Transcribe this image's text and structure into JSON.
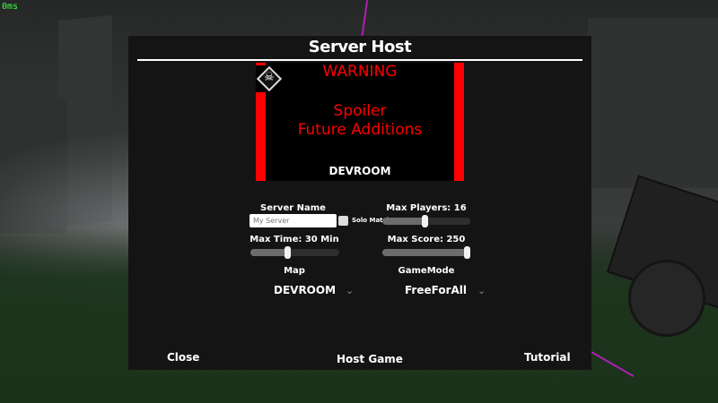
{
  "hud": {
    "fps": "0ms"
  },
  "dialog": {
    "title": "Server Host",
    "preview": {
      "warning": "WARNING",
      "spoiler_line1": "Spoiler",
      "spoiler_line2": "Future Additions",
      "map_name": "DEVROOM",
      "badge_icon": "skull-icon"
    },
    "server_name": {
      "label": "Server Name",
      "value": "My Server",
      "solo_label": "Solo Match",
      "solo_checked": false
    },
    "max_players": {
      "label": "Max Players: 16",
      "value": 16,
      "fraction": 0.48
    },
    "max_time": {
      "label": "Max Time: 30 Min",
      "value": 30,
      "fraction": 0.42
    },
    "max_score": {
      "label": "Max Score: 250",
      "value": 250,
      "fraction": 1.0
    },
    "map": {
      "label": "Map",
      "selected": "DEVROOM"
    },
    "gamemode": {
      "label": "GameMode",
      "selected": "FreeForAll"
    },
    "buttons": {
      "close": "Close",
      "host": "Host Game",
      "tutorial": "Tutorial"
    }
  },
  "colors": {
    "panel": "#141414",
    "accent_red": "#ff0000",
    "fps_green": "#3cff3c",
    "text": "#ffffff"
  }
}
